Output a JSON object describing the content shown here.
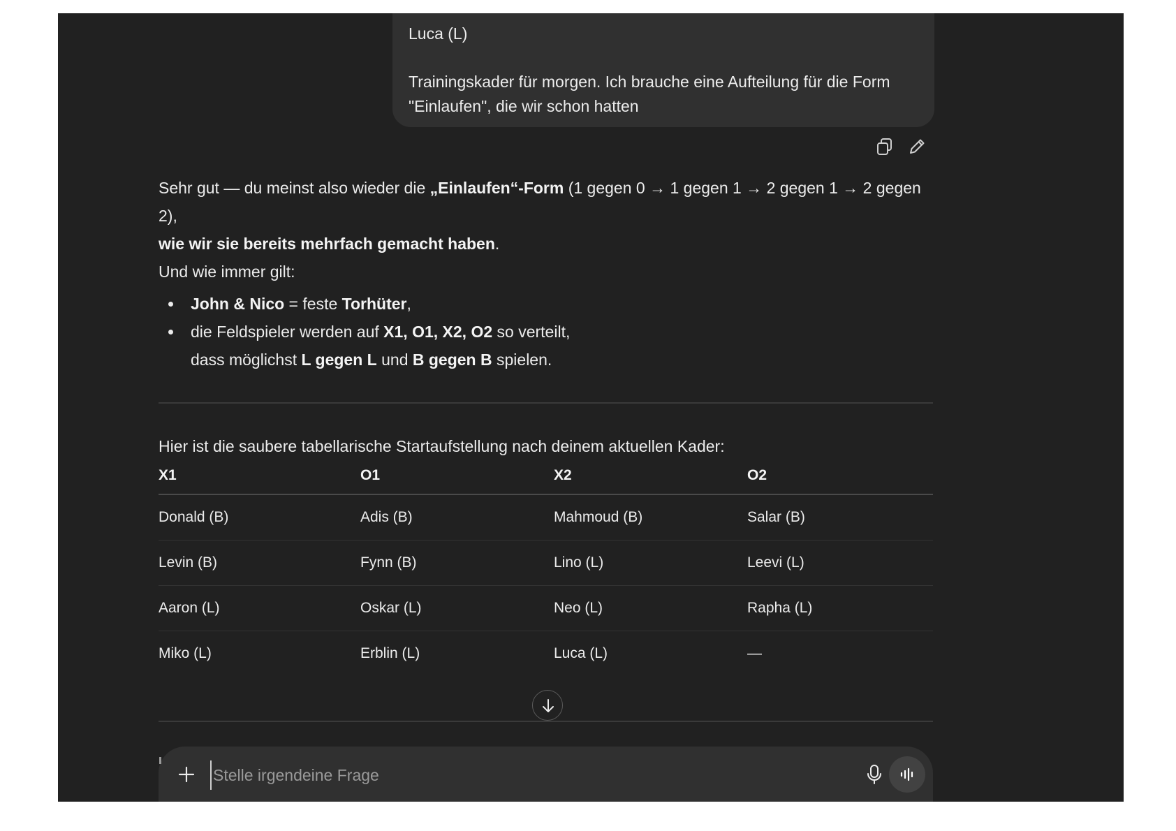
{
  "user_message": {
    "clipped_top_line": "",
    "line_luca": "Luca (L)",
    "request_line1": "Trainingskader für morgen. Ich brauche eine Aufteilung für die Form",
    "request_line2": "\"Einlaufen\", die wir schon hatten"
  },
  "message_actions": {
    "copy_icon": "copy-icon",
    "edit_icon": "pencil-icon"
  },
  "assistant": {
    "p1_a": "Sehr gut — du meinst also wieder die ",
    "p1_b": "„Einlaufen“-Form",
    "p1_c": " (1 gegen 0 → 1 gegen 1 → 2 gegen 1 → 2 gegen 2),",
    "p2_a": "wie wir sie bereits mehrfach gemacht haben",
    "p2_b": ".",
    "p3": "Und wie immer gilt:",
    "b1_a": "John & Nico",
    "b1_b": " = feste ",
    "b1_c": "Torhüter",
    "b1_d": ",",
    "b2_a": "die Feldspieler werden auf ",
    "b2_b": "X1, O1, X2, O2",
    "b2_c": " so verteilt,",
    "b2_d": "dass möglichst ",
    "b2_e": "L gegen L",
    "b2_f": " und ",
    "b2_g": "B gegen B",
    "b2_h": " spielen.",
    "intro_table": "Hier ist die saubere tabellarische Startaufstellung nach deinem aktuellen Kader:"
  },
  "table": {
    "headers": [
      "X1",
      "O1",
      "X2",
      "O2"
    ],
    "rows": [
      [
        "Donald (B)",
        "Adis (B)",
        "Mahmoud (B)",
        "Salar (B)"
      ],
      [
        "Levin (B)",
        "Fynn (B)",
        "Lino (L)",
        "Leevi (L)"
      ],
      [
        "Aaron (L)",
        "Oskar (L)",
        "Neo (L)",
        "Rapha (L)"
      ],
      [
        "Miko (L)",
        "Erblin (L)",
        "Luca (L)",
        "—"
      ]
    ]
  },
  "composer": {
    "placeholder": "Stelle irgendeine Frage",
    "plus_icon": "plus-icon",
    "mic_icon": "microphone-icon",
    "voice_icon": "voice-mode-icon"
  },
  "colors": {
    "background": "#212121",
    "bubble": "#303030",
    "text": "#ececec"
  }
}
